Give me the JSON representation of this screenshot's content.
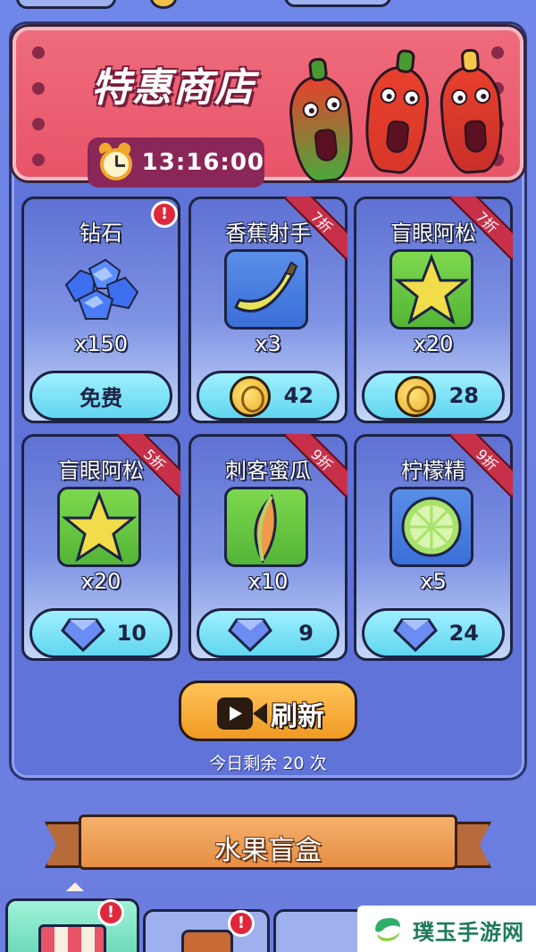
{
  "banner": {
    "title": "特惠商店",
    "timer": "13:16:00"
  },
  "items": [
    {
      "name": "钻石",
      "qty": "x150",
      "price_type": "free",
      "price_label": "免费",
      "discount": "",
      "icon": "diamond-pile-icon",
      "has_alert": true
    },
    {
      "name": "香蕉射手",
      "qty": "x3",
      "price_type": "coin",
      "price": "42",
      "discount": "7折",
      "icon": "banana-icon"
    },
    {
      "name": "盲眼阿松",
      "qty": "x20",
      "price_type": "coin",
      "price": "28",
      "discount": "7折",
      "icon": "star-fruit-icon"
    },
    {
      "name": "盲眼阿松",
      "qty": "x20",
      "price_type": "gem",
      "price": "10",
      "discount": "5折",
      "icon": "star-fruit-icon"
    },
    {
      "name": "刺客蜜瓜",
      "qty": "x10",
      "price_type": "gem",
      "price": "9",
      "discount": "9折",
      "icon": "melon-slice-icon"
    },
    {
      "name": "柠檬精",
      "qty": "x5",
      "price_type": "gem",
      "price": "24",
      "discount": "9折",
      "icon": "lime-slice-icon"
    }
  ],
  "refresh": {
    "label": "刷新",
    "remaining": "今日剩余 20 次"
  },
  "fruit_box": {
    "label": "水果盲盒"
  },
  "watermark": {
    "text": "璞玉手游网"
  },
  "colors": {
    "banner": "#e85468",
    "button_cyan": "#60d6ef",
    "refresh_orange": "#f09a22",
    "panel_blue": "#5f73d8"
  }
}
